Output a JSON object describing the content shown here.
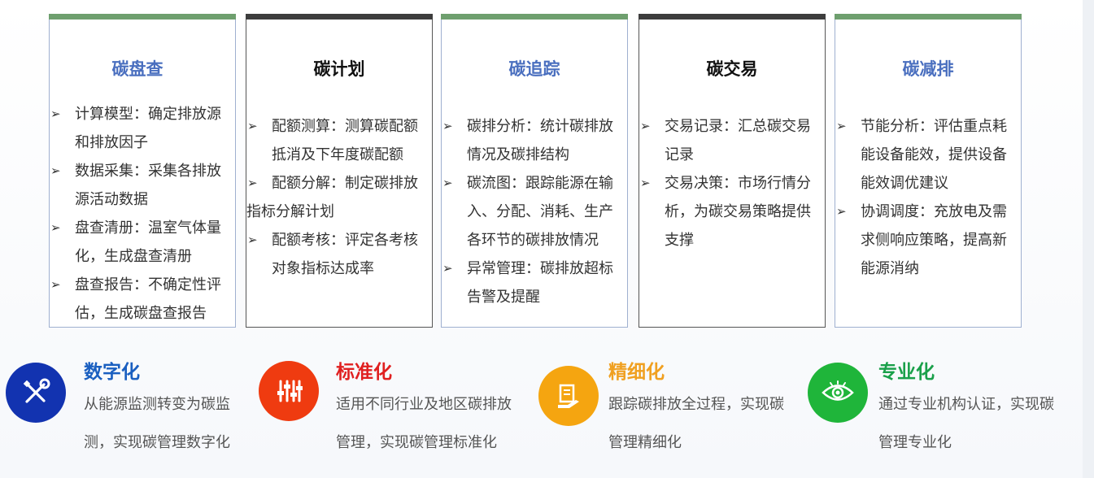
{
  "colors": {
    "accent_blue": "#4a6fbf",
    "green_bar": "#6e9f6e",
    "dark_bar": "#3d3d3d",
    "blue_circle": "#1233b0",
    "red_circle": "#ef3b10",
    "orange_circle": "#f5a510",
    "green_circle": "#1fb53a",
    "title_blue": "#1a5fc0",
    "title_red": "#e02020",
    "title_orange": "#f0a020",
    "title_green": "#1aa04a"
  },
  "cards": [
    {
      "title": "碳盘查",
      "items": [
        {
          "line1": "计算模型：确定排放源",
          "line2": "和排放因子"
        },
        {
          "line1": "数据采集：采集各排放",
          "line2": "源活动数据"
        },
        {
          "line1": "盘查清册：温室气体量",
          "line2": "化，生成盘查清册"
        },
        {
          "line1": "盘查报告：不确定性评",
          "line2": "估，生成碳盘查报告"
        }
      ]
    },
    {
      "title": "碳计划",
      "items": [
        {
          "line1": "配额测算：测算碳配额",
          "line2": "抵消及下年度碳配额"
        },
        {
          "line1": "配额分解：制定碳排放",
          "line2": "指标分解计划"
        },
        {
          "line1": "配额考核：评定各考核",
          "line2": "对象指标达成率"
        }
      ]
    },
    {
      "title": "碳追踪",
      "items": [
        {
          "line1": "碳排分析：统计碳排放",
          "line2": "情况及碳排结构"
        },
        {
          "line1": "碳流图：跟踪能源在输",
          "line2": "入、分配、消耗、生产",
          "line3": "各环节的碳排放情况"
        },
        {
          "line1": "异常管理：碳排放超标",
          "line2": "告警及提醒"
        }
      ]
    },
    {
      "title": "碳交易",
      "items": [
        {
          "line1": "交易记录：汇总碳交易",
          "line2": "记录"
        },
        {
          "line1": "交易决策：市场行情分",
          "line2": "析，为碳交易策略提供",
          "line3": "支撑"
        }
      ]
    },
    {
      "title": "碳减排",
      "items": [
        {
          "line1": "节能分析：评估重点耗",
          "line2": "能设备能效，提供设备",
          "line3": "能效调优建议"
        },
        {
          "line1": "协调调度：充放电及需",
          "line2": "求侧响应策略，提高新",
          "line3": "能源消纳"
        }
      ]
    }
  ],
  "features": [
    {
      "title": "数字化",
      "icon": "wrench-screwdriver-icon",
      "desc1": "从能源监测转变为碳监",
      "desc2": "测，实现碳管理数字化"
    },
    {
      "title": "标准化",
      "icon": "sliders-icon",
      "desc1": "适用不同行业及地区碳排放",
      "desc2": "管理，实现碳管理标准化"
    },
    {
      "title": "精细化",
      "icon": "document-hand-icon",
      "desc1": "跟踪碳排放全过程，实现碳",
      "desc2": "管理精细化"
    },
    {
      "title": "专业化",
      "icon": "eye-icon",
      "desc1": "通过专业机构认证，实现碳",
      "desc2": "管理专业化"
    }
  ]
}
